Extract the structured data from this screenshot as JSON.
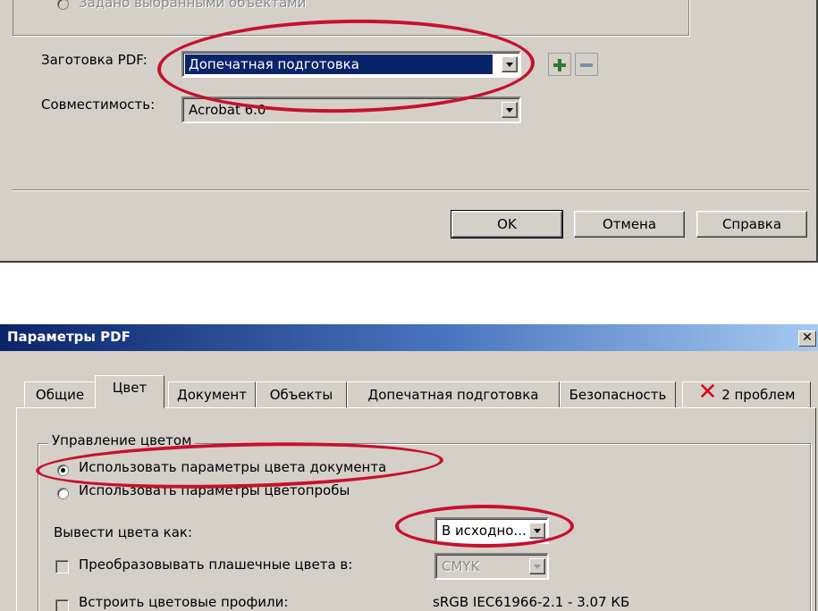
{
  "top_dialog": {
    "radio_selected_objects": "Задано выбранными объектами",
    "preset_label": "Заготовка PDF:",
    "preset_value": "Допечатная подготовка",
    "compat_label": "Совместимость:",
    "compat_value": "Acrobat 6.0",
    "ok_label": "OK",
    "cancel_label": "Отмена",
    "help_label": "Справка"
  },
  "pdf_dialog": {
    "title": "Параметры PDF",
    "close_glyph": "✕",
    "tabs": [
      {
        "label": "Общие",
        "active": false
      },
      {
        "label": "Цвет",
        "active": true
      },
      {
        "label": "Документ",
        "active": false
      },
      {
        "label": "Объекты",
        "active": false
      },
      {
        "label": "Допечатная подготовка",
        "active": false
      },
      {
        "label": "Безопасность",
        "active": false
      },
      {
        "label": "2 проблем",
        "active": false,
        "icon": "error-x-icon"
      }
    ],
    "color_group": {
      "title": "Управление цветом",
      "radio_document": "Использовать параметры цвета документа",
      "radio_proof": "Использовать параметры цветопробы",
      "output_label": "Вывести цвета как:",
      "output_value": "В исходно...",
      "convert_spot_label": "Преобразовывать плашечные цвета в:",
      "convert_spot_value": "CMYK",
      "embed_profiles_label": "Встроить цветовые профили:",
      "embed_profiles_value": "sRGB IEC61966-2.1 - 3.07 КБ"
    }
  },
  "colors": {
    "dialog_bg": "#d4d0c8",
    "title_bar": "#0a246a",
    "selection": "#0a246a",
    "annotation_ring": "#c8102e",
    "error_icon": "#e0001b"
  }
}
